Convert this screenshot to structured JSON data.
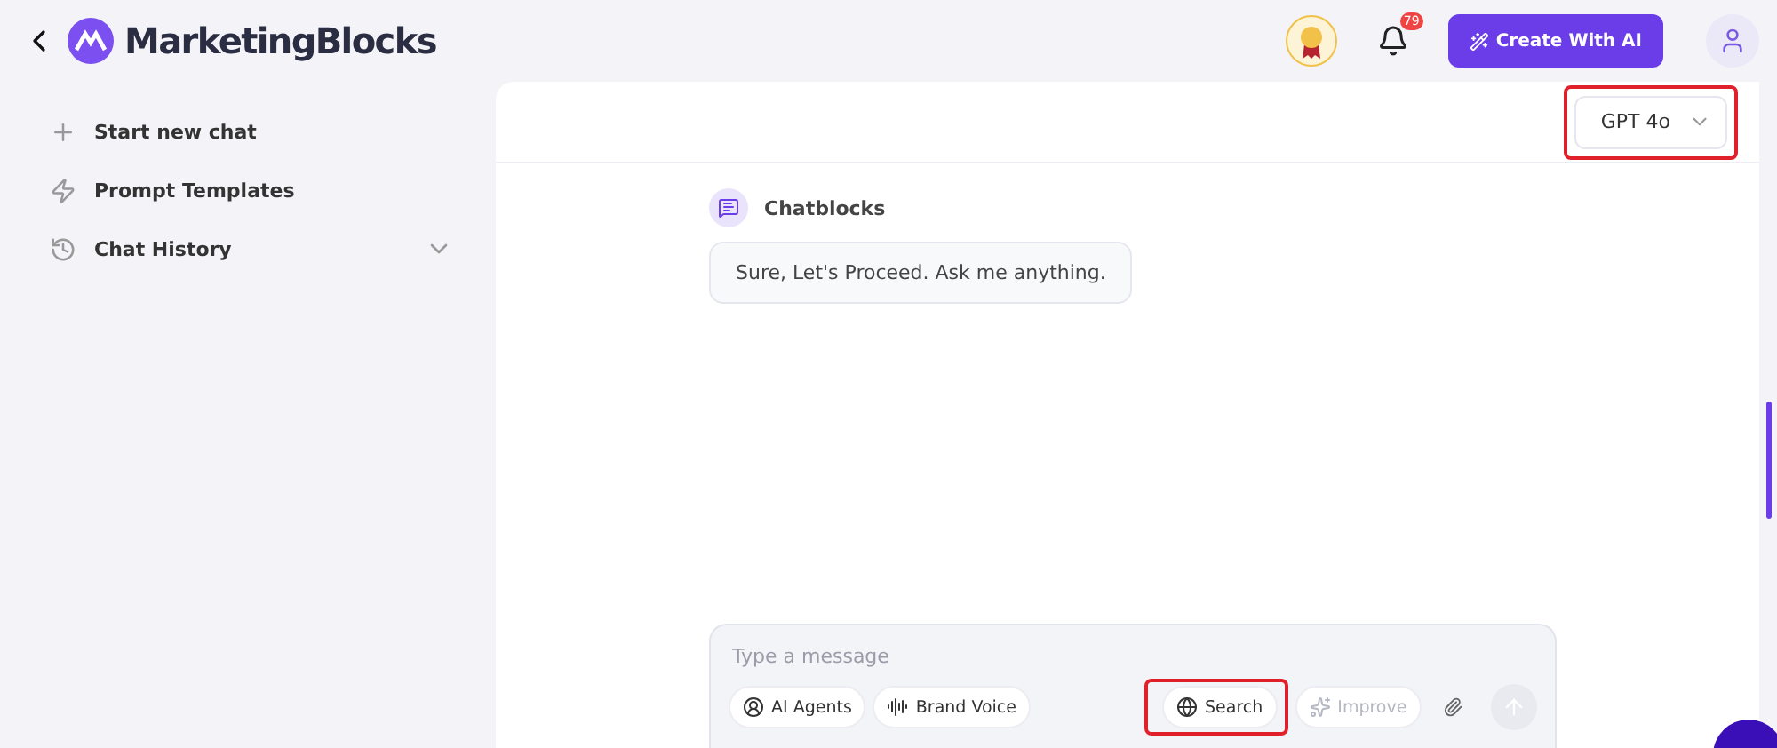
{
  "header": {
    "brand": "MarketingBlocks",
    "notification_count": "79",
    "create_button": "Create With AI"
  },
  "sidebar": {
    "items": [
      {
        "kind": "new",
        "label": "Start new chat",
        "expandable": false
      },
      {
        "kind": "templates",
        "label": "Prompt Templates",
        "expandable": false
      },
      {
        "kind": "history",
        "label": "Chat History",
        "expandable": true
      }
    ]
  },
  "model_selector": {
    "value": "GPT 4o",
    "highlighted": true
  },
  "messages": [
    {
      "sender": "Chatblocks",
      "text": "Sure, Let's Proceed. Ask me anything."
    }
  ],
  "composer": {
    "placeholder": "Type a message",
    "chips": [
      {
        "kind": "agents",
        "label": "AI Agents",
        "disabled": false,
        "highlighted": false
      },
      {
        "kind": "voice",
        "label": "Brand Voice",
        "disabled": false,
        "highlighted": false
      },
      {
        "kind": "search",
        "label": "Search",
        "disabled": false,
        "highlighted": true
      },
      {
        "kind": "improve",
        "label": "Improve",
        "disabled": true,
        "highlighted": false
      }
    ]
  }
}
